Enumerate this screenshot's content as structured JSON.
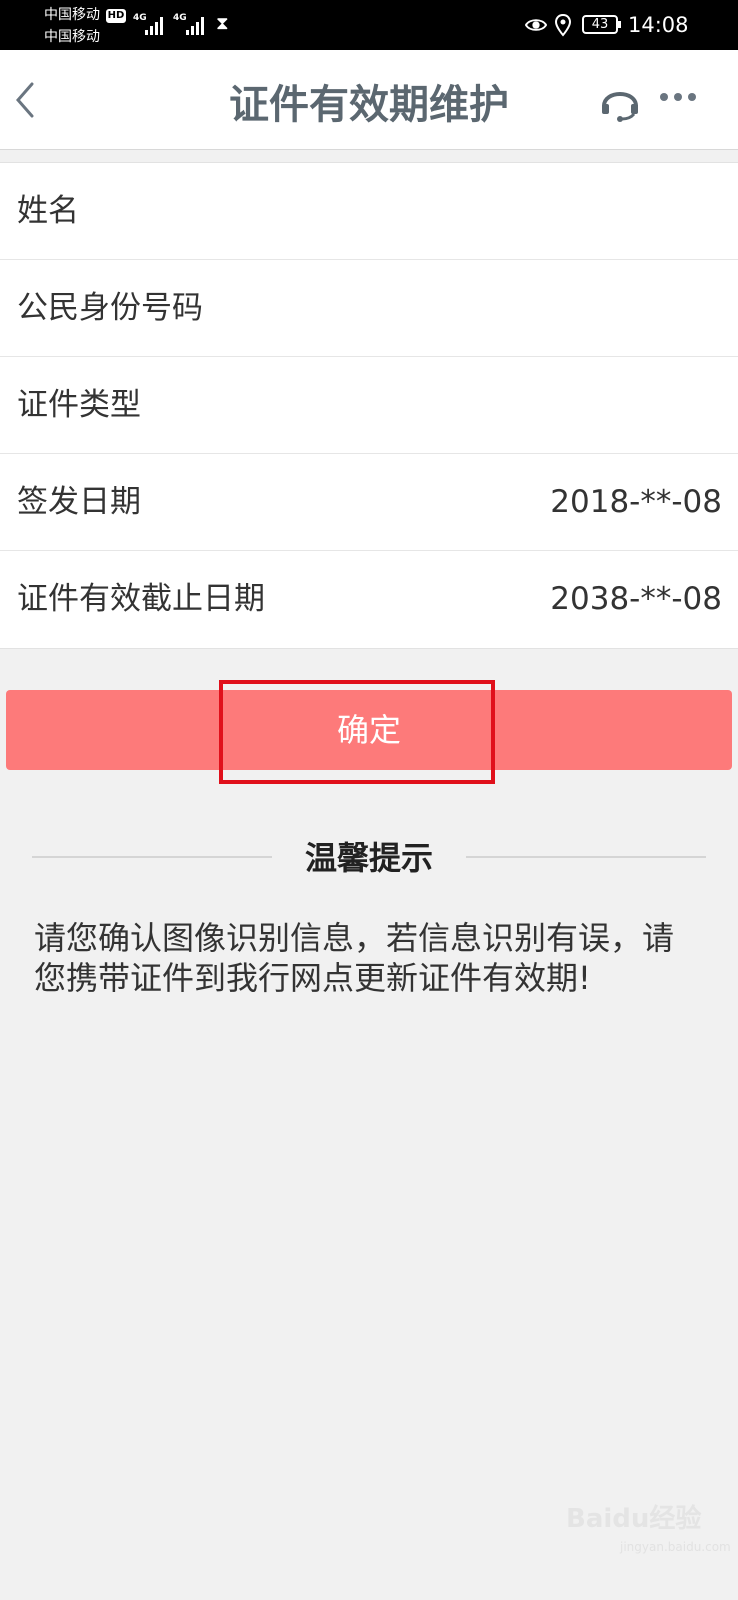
{
  "status_bar": {
    "carrier_1": "中国移动",
    "carrier_2": "中国移动",
    "hd": "HD",
    "network_1": "4G",
    "network_2": "4G",
    "battery": "43",
    "time": "14:08"
  },
  "header": {
    "title": "证件有效期维护",
    "icons": [
      "chevron-left-icon",
      "headset-icon",
      "more-icon"
    ]
  },
  "form": {
    "rows": [
      {
        "label": "姓名",
        "value": ""
      },
      {
        "label": "公民身份号码",
        "value": ""
      },
      {
        "label": "证件类型",
        "value": ""
      },
      {
        "label": "签发日期",
        "value": "2018-**-08"
      },
      {
        "label": "证件有效截止日期",
        "value": "2038-**-08"
      }
    ]
  },
  "confirm": {
    "label": "确定"
  },
  "tips": {
    "title": "温馨提示",
    "text": "请您确认图像识别信息，若信息识别有误，请您携带证件到我行网点更新证件有效期!"
  },
  "watermark": {
    "text": "Baidu经验",
    "sub": "jingyan.baidu.com"
  },
  "colors": {
    "accent": "#fd7a7a",
    "highlight": "#e0101b",
    "title": "#5b6770",
    "background": "#f1f1f1"
  }
}
